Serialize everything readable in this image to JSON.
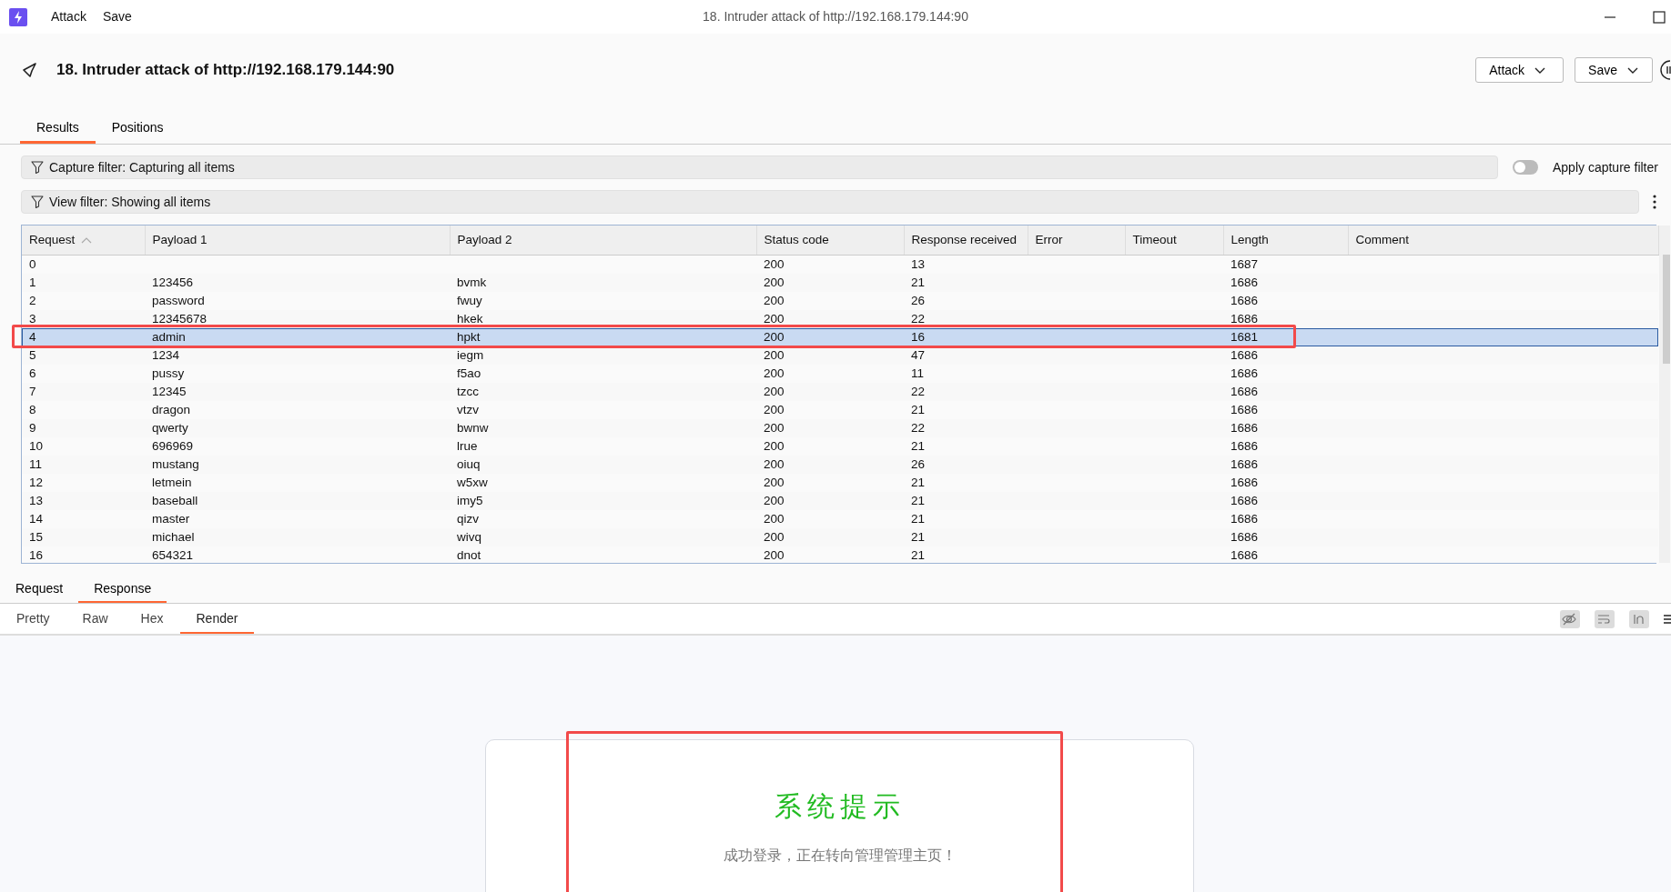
{
  "window": {
    "menu": [
      "Attack",
      "Save"
    ],
    "title": "18. Intruder attack of http://192.168.179.144:90"
  },
  "header": {
    "title": "18. Intruder attack of http://192.168.179.144:90",
    "buttons": [
      "Attack",
      "Save"
    ]
  },
  "tabs": [
    {
      "label": "Results",
      "selected": true
    },
    {
      "label": "Positions",
      "selected": false
    }
  ],
  "capture_filter": {
    "label": "Capture filter: Capturing all items",
    "toggle_label": "Apply capture filter",
    "on": false
  },
  "view_filter": {
    "label": "View filter: Showing all items"
  },
  "table": {
    "columns": [
      {
        "label": "Request",
        "sorted": true
      },
      {
        "label": "Payload 1",
        "sorted": false
      },
      {
        "label": "Payload 2",
        "sorted": false
      },
      {
        "label": "Status code",
        "sorted": false
      },
      {
        "label": "Response received",
        "sorted": false
      },
      {
        "label": "Error",
        "sorted": false
      },
      {
        "label": "Timeout",
        "sorted": false
      },
      {
        "label": "Length",
        "sorted": false
      },
      {
        "label": "Comment",
        "sorted": false
      }
    ],
    "rows": [
      {
        "cells": [
          "0",
          "",
          "",
          "200",
          "13",
          "",
          "",
          "1687",
          ""
        ],
        "selected": false,
        "highlighted": false
      },
      {
        "cells": [
          "1",
          "123456",
          "bvmk",
          "200",
          "21",
          "",
          "",
          "1686",
          ""
        ],
        "selected": false,
        "highlighted": false
      },
      {
        "cells": [
          "2",
          "password",
          "fwuy",
          "200",
          "26",
          "",
          "",
          "1686",
          ""
        ],
        "selected": false,
        "highlighted": false
      },
      {
        "cells": [
          "3",
          "12345678",
          "hkek",
          "200",
          "22",
          "",
          "",
          "1686",
          ""
        ],
        "selected": false,
        "highlighted": false
      },
      {
        "cells": [
          "4",
          "admin",
          "hpkt",
          "200",
          "16",
          "",
          "",
          "1681",
          ""
        ],
        "selected": true,
        "highlighted": true
      },
      {
        "cells": [
          "5",
          "1234",
          "iegm",
          "200",
          "47",
          "",
          "",
          "1686",
          ""
        ],
        "selected": false,
        "highlighted": false
      },
      {
        "cells": [
          "6",
          "pussy",
          "f5ao",
          "200",
          "11",
          "",
          "",
          "1686",
          ""
        ],
        "selected": false,
        "highlighted": false
      },
      {
        "cells": [
          "7",
          "12345",
          "tzcc",
          "200",
          "22",
          "",
          "",
          "1686",
          ""
        ],
        "selected": false,
        "highlighted": false
      },
      {
        "cells": [
          "8",
          "dragon",
          "vtzv",
          "200",
          "21",
          "",
          "",
          "1686",
          ""
        ],
        "selected": false,
        "highlighted": false
      },
      {
        "cells": [
          "9",
          "qwerty",
          "bwnw",
          "200",
          "22",
          "",
          "",
          "1686",
          ""
        ],
        "selected": false,
        "highlighted": false
      },
      {
        "cells": [
          "10",
          "696969",
          "lrue",
          "200",
          "21",
          "",
          "",
          "1686",
          ""
        ],
        "selected": false,
        "highlighted": false
      },
      {
        "cells": [
          "11",
          "mustang",
          "oiuq",
          "200",
          "26",
          "",
          "",
          "1686",
          ""
        ],
        "selected": false,
        "highlighted": false
      },
      {
        "cells": [
          "12",
          "letmein",
          "w5xw",
          "200",
          "21",
          "",
          "",
          "1686",
          ""
        ],
        "selected": false,
        "highlighted": false
      },
      {
        "cells": [
          "13",
          "baseball",
          "imy5",
          "200",
          "21",
          "",
          "",
          "1686",
          ""
        ],
        "selected": false,
        "highlighted": false
      },
      {
        "cells": [
          "14",
          "master",
          "qizv",
          "200",
          "21",
          "",
          "",
          "1686",
          ""
        ],
        "selected": false,
        "highlighted": false
      },
      {
        "cells": [
          "15",
          "michael",
          "wivq",
          "200",
          "21",
          "",
          "",
          "1686",
          ""
        ],
        "selected": false,
        "highlighted": false
      },
      {
        "cells": [
          "16",
          "654321",
          "dnot",
          "200",
          "21",
          "",
          "",
          "1686",
          ""
        ],
        "selected": false,
        "highlighted": false
      }
    ]
  },
  "message_tabs": [
    {
      "label": "Request",
      "selected": false
    },
    {
      "label": "Response",
      "selected": true
    }
  ],
  "view_tabs": [
    {
      "label": "Pretty",
      "selected": false
    },
    {
      "label": "Raw",
      "selected": false
    },
    {
      "label": "Hex",
      "selected": false
    },
    {
      "label": "Render",
      "selected": true
    }
  ],
  "render": {
    "title": "系统提示",
    "message": "成功登录，正在转向管理管理主页！",
    "highlighted": true
  }
}
